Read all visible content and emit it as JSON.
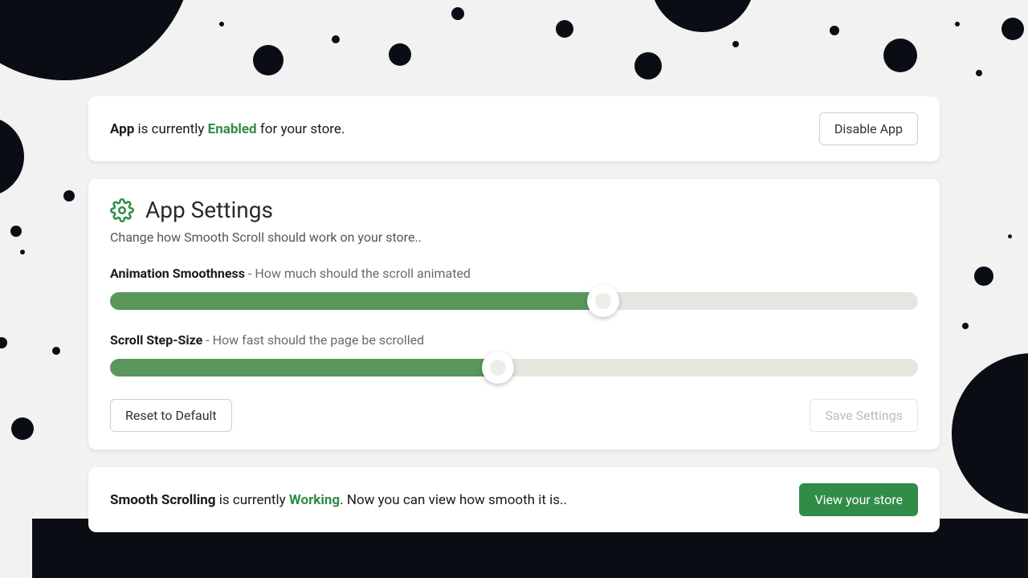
{
  "status": {
    "prefix": "App",
    "middle": " is currently ",
    "state": "Enabled",
    "suffix": " for your store.",
    "disable_button": "Disable App"
  },
  "settings": {
    "title": "App Settings",
    "subtitle": "Change how Smooth Scroll should work on your store..",
    "slider1": {
      "label_strong": "Animation Smoothness",
      "label_rest": " - How much should the scroll animated",
      "percent": 61
    },
    "slider2": {
      "label_strong": "Scroll Step-Size",
      "label_rest": " - How fast should the page be scrolled",
      "percent": 48
    },
    "reset_button": "Reset to Default",
    "save_button": "Save Settings"
  },
  "working": {
    "prefix": "Smooth Scrolling",
    "middle": " is currently ",
    "state": "Working",
    "suffix": ". Now you can view how smooth it is..",
    "view_button": "View your store"
  },
  "colors": {
    "green": "#318c48"
  }
}
